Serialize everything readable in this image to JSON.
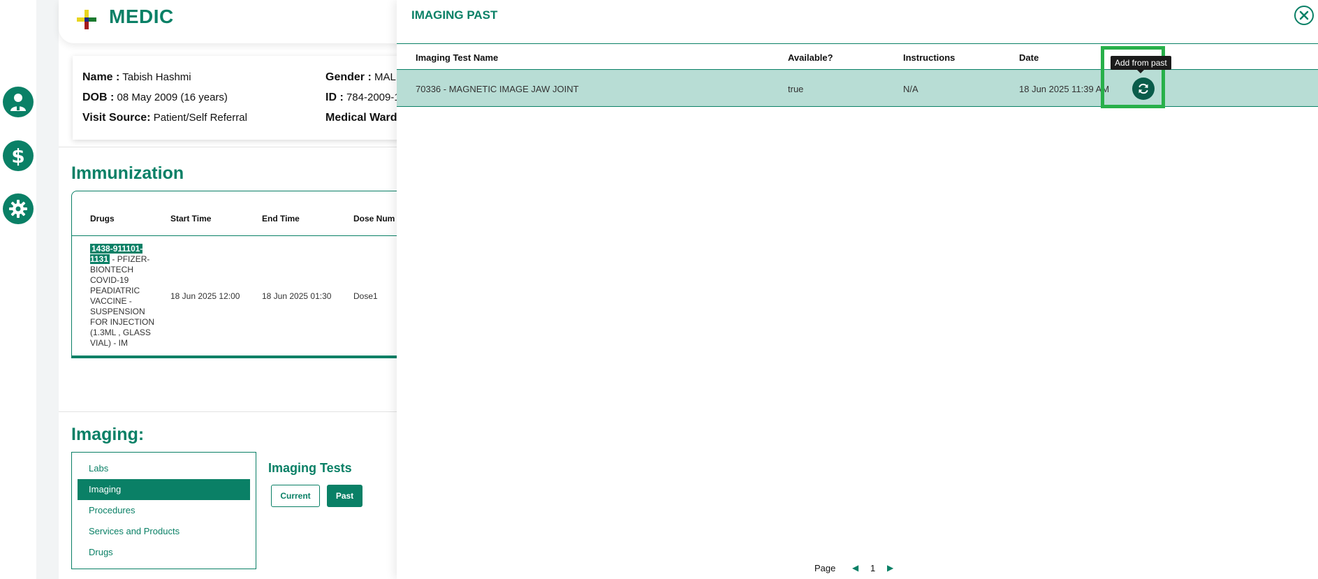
{
  "brand": {
    "name": "MEDIC"
  },
  "rail": {
    "icons": [
      "doctor-icon",
      "dollar-icon",
      "gear-icon"
    ]
  },
  "patient": {
    "name_label": "Name :",
    "name_value": "Tabish Hashmi",
    "dob_label": "DOB :",
    "dob_value": "08 May 2009 (16 years)",
    "visit_label": "Visit Source:",
    "visit_value": "Patient/Self Referral",
    "gender_label": "Gender :",
    "gender_value": "MALE",
    "id_label": "ID :",
    "id_value": "784-2009-1",
    "ward_label": "Medical Ward:"
  },
  "immunization": {
    "title": "Immunization",
    "columns": [
      "Drugs",
      "Start Time",
      "End Time",
      "Dose Num"
    ],
    "rows": [
      {
        "drug_code": "1438-911101-1131",
        "drug_desc": " - PFIZER-BIONTECH COVID-19 PEADIATRIC VACCINE - SUSPENSION FOR INJECTION (1.3ML , GLASS VIAL) - IM",
        "start": "18 Jun 2025 12:00",
        "end": "18 Jun 2025 01:30",
        "dose": "Dose1"
      }
    ]
  },
  "imaging": {
    "title": "Imaging:",
    "nav": [
      "Labs",
      "Imaging",
      "Procedures",
      "Services and Products",
      "Drugs"
    ],
    "active_nav": "Imaging",
    "tests_title": "Imaging Tests",
    "current_label": "Current",
    "past_label": "Past"
  },
  "drawer": {
    "title": "IMAGING PAST",
    "columns": [
      "Imaging Test Name",
      "Available?",
      "Instructions",
      "Date"
    ],
    "rows": [
      {
        "name": "70336 - MAGNETIC IMAGE JAW JOINT",
        "available": "true",
        "instructions": "N/A",
        "date": "18 Jun 2025 11:39 AM"
      }
    ],
    "tooltip": "Add from past",
    "pager": {
      "label": "Page",
      "current": "1"
    }
  },
  "colors": {
    "accent": "#0a8066",
    "row_selected": "#b8ddd5",
    "highlight": "#28b04a"
  }
}
